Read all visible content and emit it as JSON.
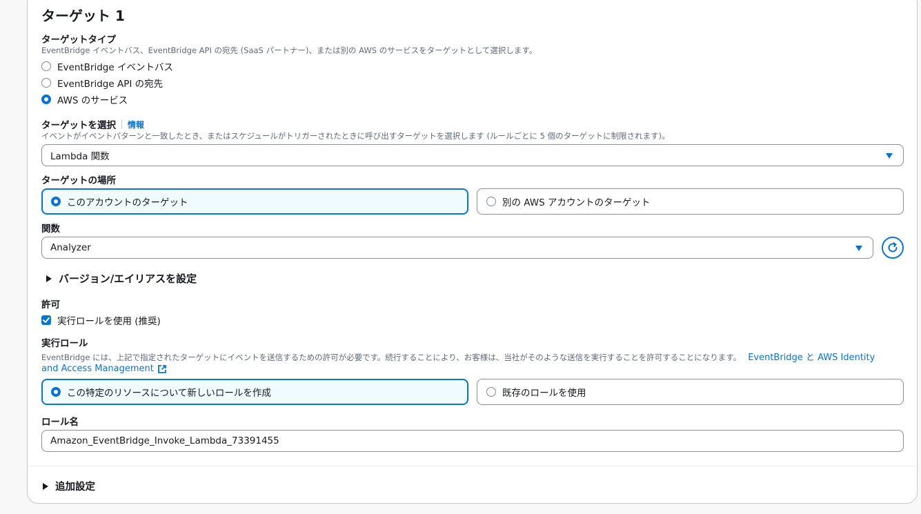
{
  "section_title": "ターゲット 1",
  "target_type": {
    "label": "ターゲットタイプ",
    "description": "EventBridge イベントバス、EventBridge API の宛先 (SaaS パートナー)、または別の AWS のサービスをターゲットとして選択します。",
    "options": [
      "EventBridge イベントバス",
      "EventBridge API の宛先",
      "AWS のサービス"
    ],
    "selected_index": 2
  },
  "select_target": {
    "label": "ターゲットを選択",
    "info": "情報",
    "description": "イベントがイベントパターンと一致したとき、またはスケジュールがトリガーされたときに呼び出すターゲットを選択します (ルールごとに 5 個のターゲットに制限されます)。",
    "value": "Lambda 関数"
  },
  "target_location": {
    "label": "ターゲットの場所",
    "options": [
      "このアカウントのターゲット",
      "別の AWS アカウントのターゲット"
    ],
    "selected_index": 0
  },
  "function": {
    "label": "関数",
    "value": "Analyzer"
  },
  "version_alias": {
    "label": "バージョン/エイリアスを設定"
  },
  "permission": {
    "label": "許可",
    "checkbox_label": "実行ロールを使用 (推奨)",
    "checked": true
  },
  "execution_role": {
    "label": "実行ロール",
    "description": "EventBridge には、上記で指定されたターゲットにイベントを送信するための許可が必要です。続行することにより、お客様は、当社がそのような送信を実行することを許可することになります。",
    "link_part1": "EventBridge と AWS Identity",
    "link_part2": "and Access Management",
    "options": [
      "この特定のリソースについて新しいロールを作成",
      "既存のロールを使用"
    ],
    "selected_index": 0
  },
  "role_name": {
    "label": "ロール名",
    "value": "Amazon_EventBridge_Invoke_Lambda_73391455"
  },
  "additional_settings": {
    "label": "追加設定"
  },
  "colors": {
    "accent": "#0972d3",
    "selected_tile_bg": "#f0fbff",
    "text": "#16191f",
    "muted": "#5f6b7a"
  },
  "icons": [
    "radio-icon",
    "caret-down-icon",
    "refresh-icon",
    "checkbox-icon",
    "external-link-icon",
    "triangle-right-icon"
  ]
}
